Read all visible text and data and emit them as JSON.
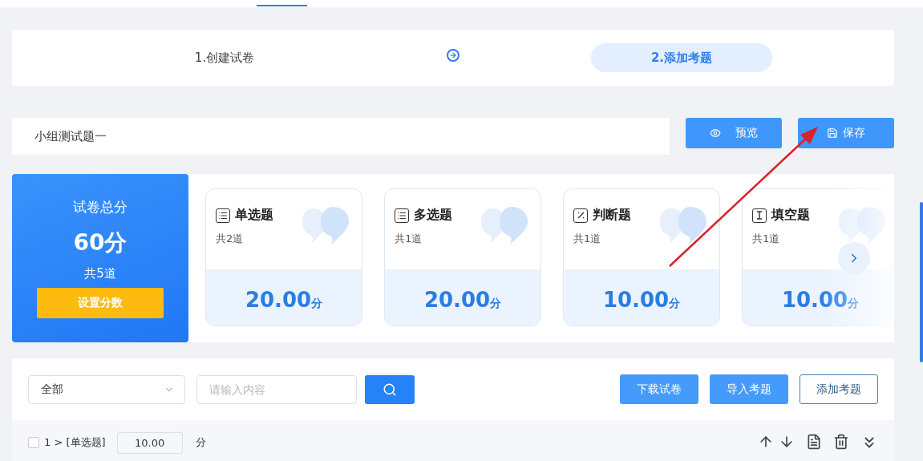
{
  "steps": [
    {
      "label": "1.创建试卷",
      "selected": false
    },
    {
      "label": "2.添加考题",
      "selected": true
    }
  ],
  "paper": {
    "title_value": "小组测试题一",
    "buttons": [
      {
        "label": "预览",
        "kind": "preview"
      },
      {
        "label": "保存",
        "kind": "save"
      }
    ]
  },
  "summary": {
    "title": "试卷总分",
    "total": "60分",
    "count": "共5道",
    "button": "设置分数"
  },
  "question_types": [
    {
      "kind": "single",
      "name": "单选题",
      "count": "共2道",
      "score": "20.00",
      "unit": "分"
    },
    {
      "kind": "multiple",
      "name": "多选题",
      "count": "共1道",
      "score": "20.00",
      "unit": "分"
    },
    {
      "kind": "judge",
      "name": "判断题",
      "count": "共1道",
      "score": "10.00",
      "unit": "分"
    },
    {
      "kind": "blank",
      "name": "填空题",
      "count": "共1道",
      "score": "10.00",
      "unit": "分"
    }
  ],
  "filter": {
    "type_value": "全部",
    "search_placeholder": "请输入内容"
  },
  "actions": [
    {
      "label": "下载试卷",
      "kind": "filled"
    },
    {
      "label": "导入考题",
      "kind": "filled"
    },
    {
      "label": "添加考题",
      "kind": "outline"
    }
  ],
  "questions": [
    {
      "checked": false,
      "label": "1 > [单选题]",
      "score": "10.00",
      "unit": "分"
    }
  ]
}
